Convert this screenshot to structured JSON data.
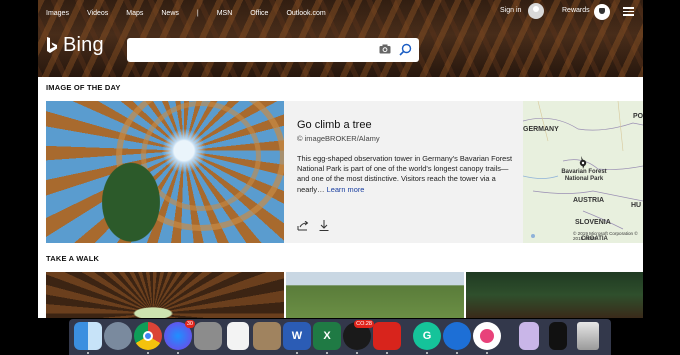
{
  "header": {
    "nav": [
      "Images",
      "Videos",
      "Maps",
      "News",
      "|",
      "MSN",
      "Office",
      "Outlook.com"
    ],
    "sign_in": "Sign in",
    "rewards": "Rewards",
    "logo_text": "Bing"
  },
  "search": {
    "placeholder": ""
  },
  "image_of_the_day": {
    "section_title": "IMAGE OF THE DAY",
    "title": "Go climb a tree",
    "credit": "© imageBROKER/Alamy",
    "description": "This egg-shaped observation tower in Germany's Bavarian Forest National Park is part of one of the world's longest canopy trails—and one of the most distinctive. Visitors reach the tower via a nearly…",
    "learn_more": "Learn more",
    "map": {
      "labels": [
        "GERMANY",
        "PO",
        "Bavarian Forest National Park",
        "AUSTRIA",
        "HU",
        "SLOVENIA",
        "CROATIA"
      ],
      "copyright": "© 2019 Microsoft Corporation © 2018 HERE"
    }
  },
  "take_a_walk": {
    "section_title": "TAKE A WALK"
  },
  "dock": {
    "apps": [
      "Finder",
      "Launchpad",
      "Chrome",
      "Messenger",
      "System Preferences",
      "Notes",
      "Notebook",
      "Word",
      "Excel",
      "Game",
      "Acrobat",
      "Grammarly",
      "Edge",
      "iTunes",
      "Preview",
      "Terminal",
      "Trash"
    ],
    "badges": {
      "messenger": "30",
      "game": "CO.28"
    },
    "word_letter": "W",
    "excel_letter": "X",
    "grammarly_letter": "G"
  }
}
